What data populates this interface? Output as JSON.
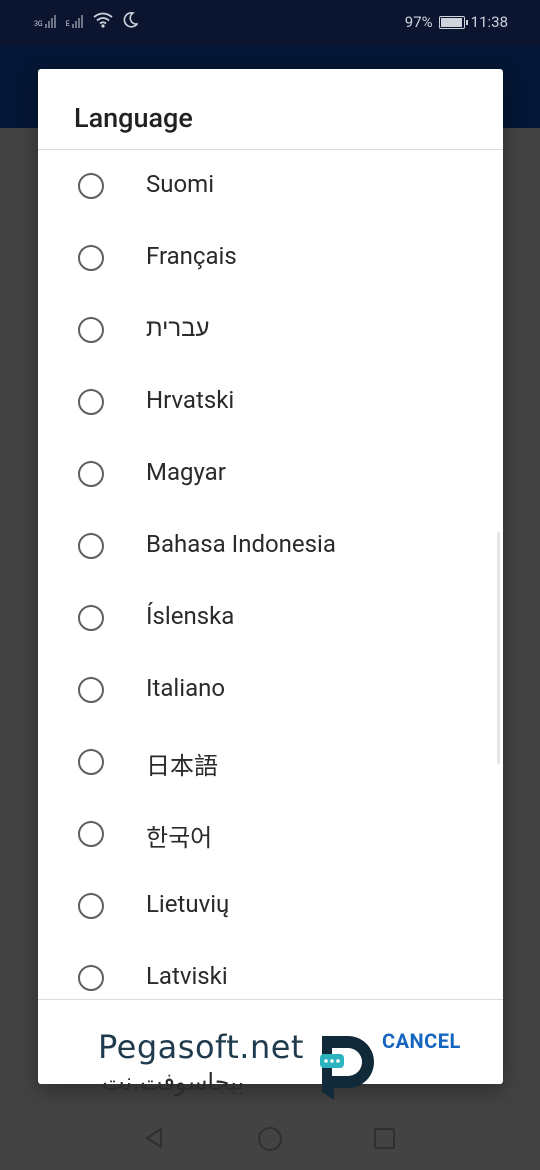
{
  "status_bar": {
    "network_label_1": "3G",
    "network_label_2": "E",
    "battery_percent": "97%",
    "battery_level": 0.97,
    "time": "11:38"
  },
  "dialog": {
    "title": "Language",
    "options": [
      {
        "label": "Suomi",
        "selected": false
      },
      {
        "label": "Français",
        "selected": false
      },
      {
        "label": "עברית",
        "selected": false
      },
      {
        "label": "Hrvatski",
        "selected": false
      },
      {
        "label": "Magyar",
        "selected": false
      },
      {
        "label": "Bahasa Indonesia",
        "selected": false
      },
      {
        "label": "Íslenska",
        "selected": false
      },
      {
        "label": "Italiano",
        "selected": false
      },
      {
        "label": "日本語",
        "selected": false
      },
      {
        "label": "한국어",
        "selected": false
      },
      {
        "label": "Lietuvių",
        "selected": false
      },
      {
        "label": "Latviski",
        "selected": false
      }
    ],
    "cancel_label": "CANCEL"
  },
  "watermark": {
    "text": "Pegasoft.net",
    "subtext": "بیجاسوفت.نت"
  },
  "colors": {
    "status_bar_bg": "#0c1530",
    "app_bar_bg": "#0a2a63",
    "accent": "#1565c0"
  },
  "nav_bar": {
    "icons": [
      "back-icon",
      "home-icon",
      "recents-icon"
    ]
  }
}
